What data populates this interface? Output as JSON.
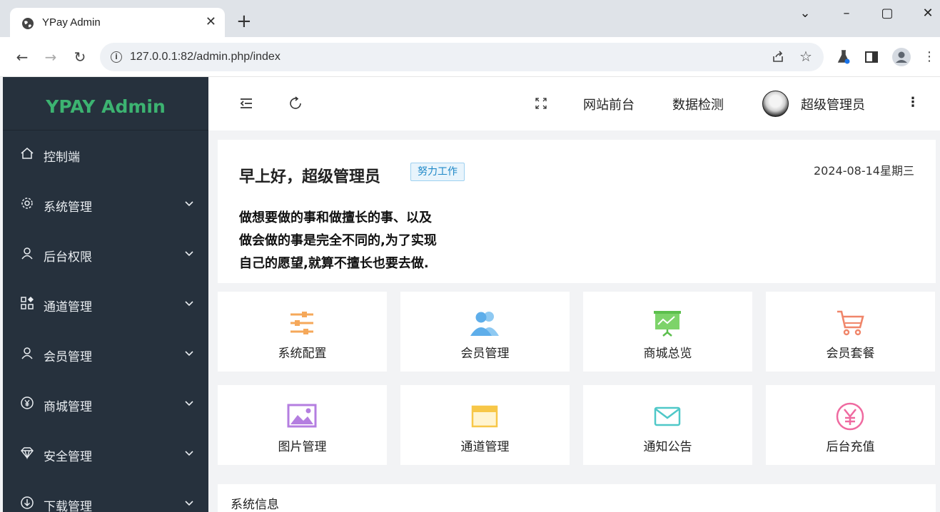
{
  "browser": {
    "tab_title": "YPay Admin",
    "url": "127.0.0.1:82/admin.php/index"
  },
  "sidebar": {
    "brand": "YPAY Admin",
    "items": [
      {
        "label": "控制端",
        "icon": "home-icon",
        "has_arrow": false
      },
      {
        "label": "系统管理",
        "icon": "gear-icon",
        "has_arrow": true
      },
      {
        "label": "后台权限",
        "icon": "user-icon",
        "has_arrow": true
      },
      {
        "label": "通道管理",
        "icon": "apps-icon",
        "has_arrow": true
      },
      {
        "label": "会员管理",
        "icon": "user-icon",
        "has_arrow": true
      },
      {
        "label": "商城管理",
        "icon": "yen-circle-icon",
        "has_arrow": true
      },
      {
        "label": "安全管理",
        "icon": "diamond-icon",
        "has_arrow": true
      },
      {
        "label": "下载管理",
        "icon": "download-icon",
        "has_arrow": true
      }
    ]
  },
  "header": {
    "site_front": "网站前台",
    "data_check": "数据检测",
    "user_name": "超级管理员"
  },
  "welcome": {
    "greeting": "早上好，超级管理员",
    "badge": "努力工作",
    "date": "2024-08-14星期三",
    "quote_lines": [
      "做想要做的事和做擅长的事、以及",
      "做会做的事是完全不同的,为了实现",
      "自己的愿望,就算不擅长也要去做."
    ]
  },
  "quick_cards": [
    {
      "label": "系统配置",
      "icon": "sliders-icon",
      "color": "#f5a85a"
    },
    {
      "label": "会员管理",
      "icon": "users-icon",
      "color": "#6bb8f0"
    },
    {
      "label": "商城总览",
      "icon": "presentation-icon",
      "color": "#7dd36a"
    },
    {
      "label": "会员套餐",
      "icon": "cart-icon",
      "color": "#f0866a"
    },
    {
      "label": "图片管理",
      "icon": "image-icon",
      "color": "#b47ee0"
    },
    {
      "label": "通道管理",
      "icon": "card-icon",
      "color": "#f7c748"
    },
    {
      "label": "通知公告",
      "icon": "mail-icon",
      "color": "#4fc8c8"
    },
    {
      "label": "后台充值",
      "icon": "yen-icon",
      "color": "#ef6aa0"
    }
  ],
  "system_info": {
    "title": "系统信息"
  }
}
